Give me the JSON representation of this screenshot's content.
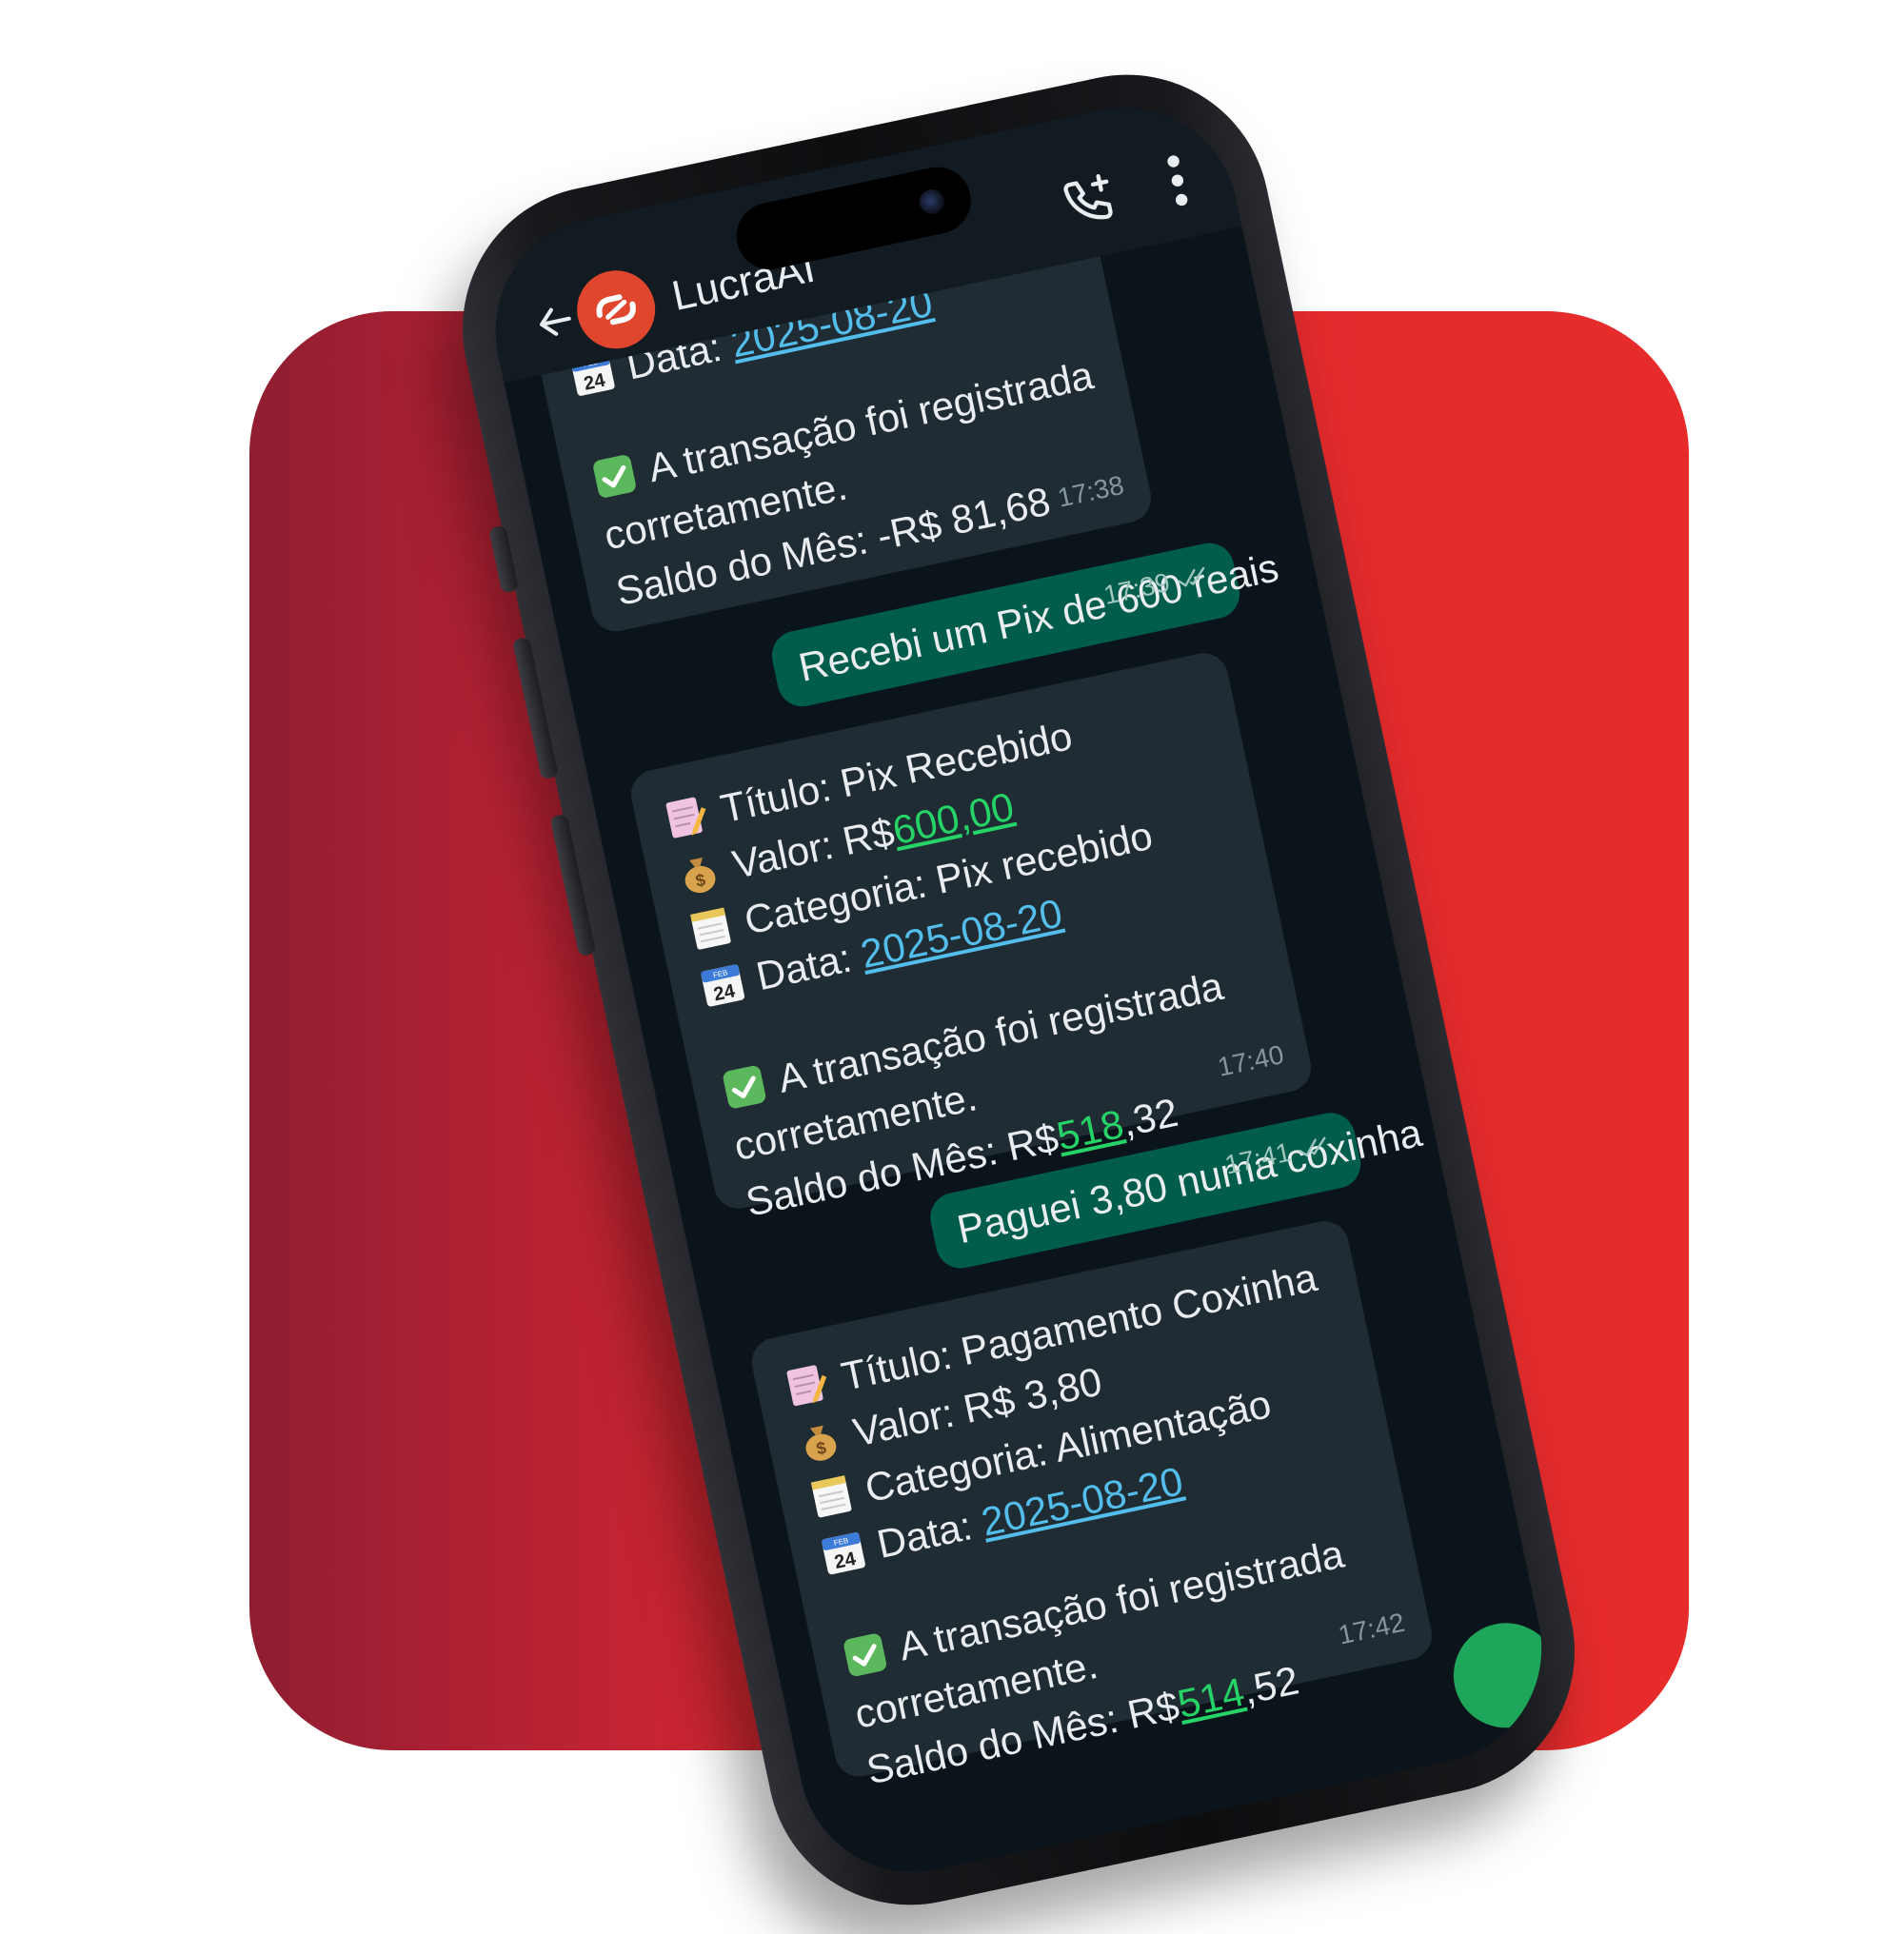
{
  "header": {
    "chat_name": "LucraAI"
  },
  "messages": [
    {
      "direction": "in",
      "date_label": "Data:",
      "date": "2025-08-20",
      "confirm": "A transação foi registrada",
      "confirm2": "corretamente.",
      "saldo_label": "Saldo do Mês: -R$ 81,68",
      "time": "17:38"
    },
    {
      "direction": "out",
      "text": "Recebi um Pix de 600 reais",
      "time": "17:39"
    },
    {
      "direction": "in",
      "title": "Título: Pix Recebido",
      "valor_label": "Valor: R$ ",
      "valor_link": "600,00",
      "valor_rest": "",
      "categoria": "Categoria: Pix recebido",
      "date_label": "Data:",
      "date": "2025-08-20",
      "confirm": "A transação foi registrada",
      "confirm2": "corretamente.",
      "saldo_label": "Saldo do Mês: R$ ",
      "saldo_link": "518",
      "saldo_rest": ",32",
      "time": "17:40"
    },
    {
      "direction": "out",
      "text": "Paguei 3,80 numa coxinha",
      "time": "17:41"
    },
    {
      "direction": "in",
      "title": "Título: Pagamento Coxinha",
      "valor_label": "Valor: R$ 3,80",
      "categoria": "Categoria: Alimentação",
      "date_label": "Data:",
      "date": "2025-08-20",
      "confirm": "A transação foi registrada",
      "confirm2": "corretamente.",
      "saldo_label": "Saldo do Mês: R$ ",
      "saldo_link": "514",
      "saldo_rest": ",52",
      "time": "17:42"
    }
  ],
  "colors": {
    "background_red": "#e72b2b",
    "incoming_bubble": "#202c33",
    "outgoing_bubble": "#005c4b",
    "link": "#53bdeb",
    "number": "#25d366"
  },
  "icons": {
    "calendar": "calendar-icon",
    "check": "check-mark-icon",
    "memo": "memo-icon",
    "money_bag": "money-bag-icon",
    "notepad": "notepad-icon"
  }
}
